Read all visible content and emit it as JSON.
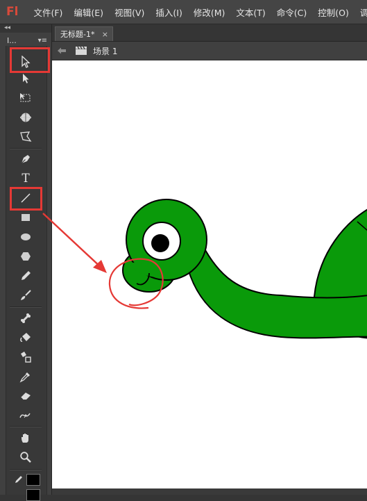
{
  "app": {
    "logo": "Fl",
    "menus": [
      "文件(F)",
      "编辑(E)",
      "视图(V)",
      "插入(I)",
      "修改(M)",
      "文本(T)",
      "命令(C)",
      "控制(O)",
      "调试"
    ]
  },
  "tools_panel": {
    "collapse_glyph": "◂◂",
    "title": "I...",
    "menu_glyph": "▾≡",
    "tools": [
      {
        "name": "selection-tool",
        "selected": true
      },
      {
        "name": "subselection-tool"
      },
      {
        "name": "free-transform-tool"
      },
      {
        "name": "3d-rotation-tool"
      },
      {
        "name": "lasso-tool"
      },
      {
        "name": "pen-tool"
      },
      {
        "name": "text-tool",
        "glyph": "T"
      },
      {
        "name": "line-tool",
        "highlighted": true
      },
      {
        "name": "rectangle-tool"
      },
      {
        "name": "oval-tool"
      },
      {
        "name": "polystar-tool"
      },
      {
        "name": "pencil-tool"
      },
      {
        "name": "brush-tool"
      },
      {
        "name": "bone-tool"
      },
      {
        "name": "paint-bucket-tool"
      },
      {
        "name": "ink-bottle-tool"
      },
      {
        "name": "eyedropper-tool"
      },
      {
        "name": "eraser-tool"
      },
      {
        "name": "width-tool"
      },
      {
        "name": "hand-tool"
      },
      {
        "name": "zoom-tool"
      }
    ],
    "stroke_color": "#000000",
    "fill_color": "#000000"
  },
  "document": {
    "tab_label": "无标题-1*",
    "tab_close": "×",
    "scene_label": "场景 1"
  },
  "colors": {
    "highlight": "#e53935",
    "turtle_green": "#0a9a0a",
    "stage": "#ffffff"
  }
}
